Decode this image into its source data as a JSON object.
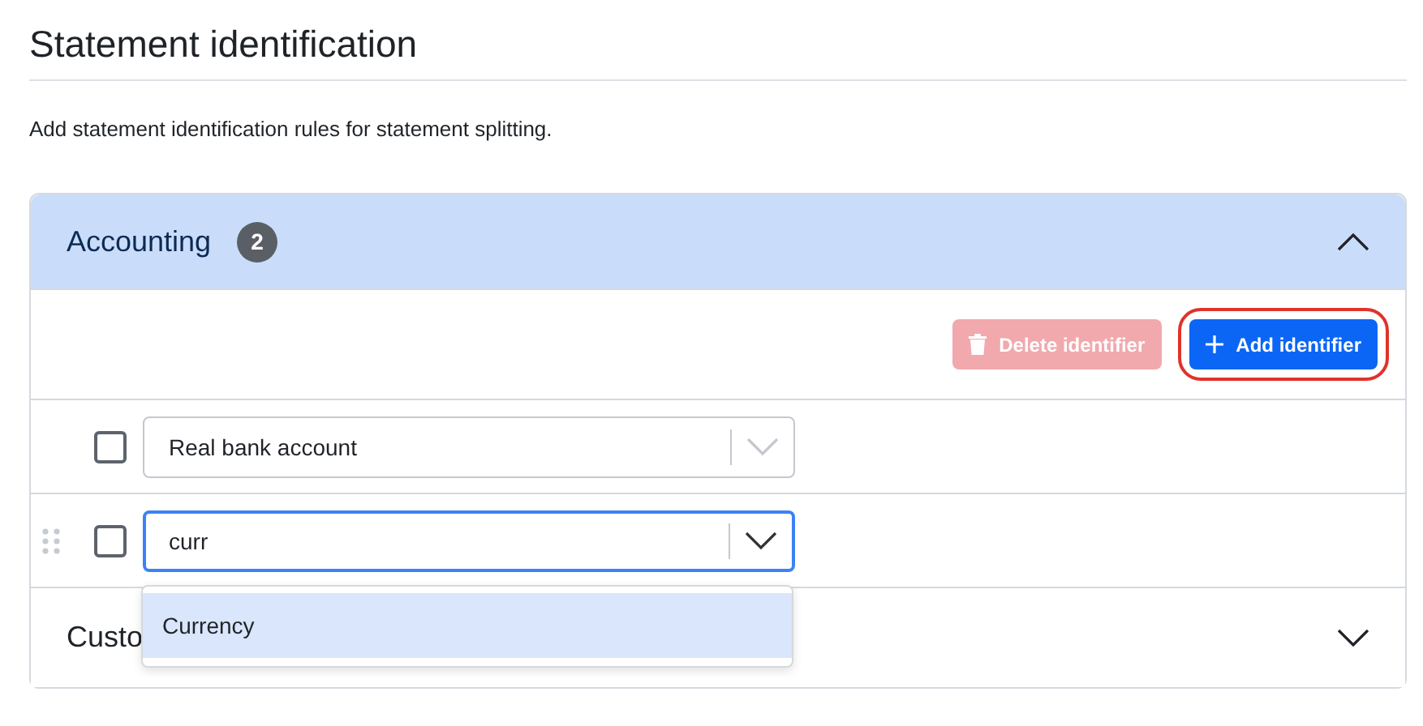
{
  "page": {
    "title": "Statement identification",
    "description": "Add statement identification rules for statement splitting."
  },
  "sections": [
    {
      "title": "Accounting",
      "count": "2",
      "expanded": true,
      "toolbar": [
        {
          "kind": "delete",
          "label": "Delete identifier",
          "disabled": true,
          "highlighted": false
        },
        {
          "kind": "add",
          "label": "Add identifier",
          "disabled": false,
          "highlighted": true
        }
      ],
      "rows": [
        {
          "checked": false,
          "drag_handle": false,
          "focused": false,
          "value": "Real bank account",
          "options": []
        },
        {
          "checked": false,
          "drag_handle": true,
          "focused": true,
          "value": "curr",
          "options": [
            {
              "label": "Currency",
              "selected": true
            }
          ]
        }
      ]
    },
    {
      "title": "Custo",
      "expanded": false
    }
  ]
}
